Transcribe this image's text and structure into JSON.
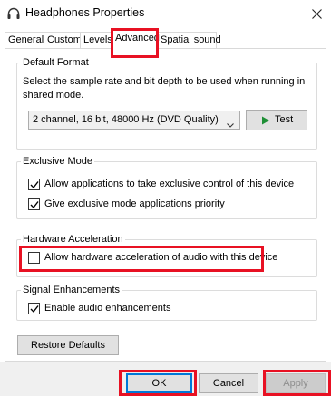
{
  "window": {
    "title": "Headphones Properties",
    "icon": "headphones-icon",
    "close_icon": "close-icon"
  },
  "tabs": [
    {
      "label": "General"
    },
    {
      "label": "Custom"
    },
    {
      "label": "Levels"
    },
    {
      "label": "Advanced",
      "active": true
    },
    {
      "label": "Spatial sound"
    }
  ],
  "default_format": {
    "group_label": "Default Format",
    "description": "Select the sample rate and bit depth to be used when running in shared mode.",
    "selected_format": "2 channel, 16 bit, 48000 Hz (DVD Quality)",
    "test_button": "Test"
  },
  "exclusive_mode": {
    "group_label": "Exclusive Mode",
    "options": [
      {
        "label": "Allow applications to take exclusive control of this device",
        "checked": true
      },
      {
        "label": "Give exclusive mode applications priority",
        "checked": true
      }
    ]
  },
  "hardware_acceleration": {
    "group_label": "Hardware Acceleration",
    "option": {
      "label": "Allow hardware acceleration of audio with this device",
      "checked": false
    }
  },
  "signal_enhancements": {
    "group_label": "Signal Enhancements",
    "option": {
      "label": "Enable audio enhancements",
      "checked": true
    }
  },
  "restore_defaults": "Restore Defaults",
  "footer": {
    "ok": "OK",
    "cancel": "Cancel",
    "apply": "Apply"
  },
  "colors": {
    "highlight": "#e81123",
    "test_arrow": "#1e8f35",
    "focus_border": "#0078d7"
  }
}
